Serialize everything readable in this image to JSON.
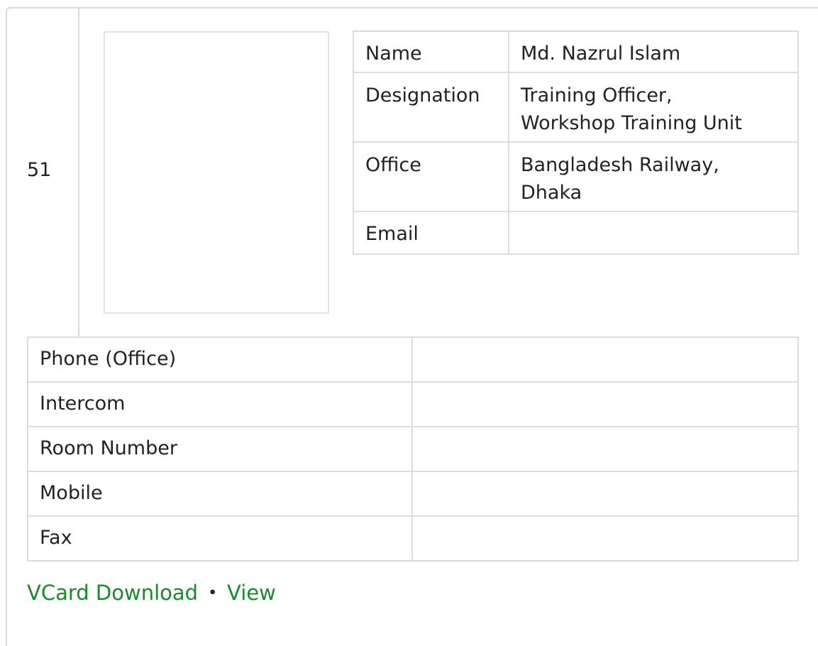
{
  "serial": "51",
  "info": {
    "name_label": "Name",
    "name_value": "Md. Nazrul Islam",
    "designation_label": "Designation",
    "designation_line1": "Training Officer,",
    "designation_line2": "Workshop Training Unit",
    "office_label": "Office",
    "office_line1": "Bangladesh Railway,",
    "office_line2": "Dhaka",
    "email_label": "Email",
    "email_value": ""
  },
  "contact": [
    {
      "label": "Phone (Office)",
      "value": ""
    },
    {
      "label": "Intercom",
      "value": ""
    },
    {
      "label": "Room Number",
      "value": ""
    },
    {
      "label": "Mobile",
      "value": ""
    },
    {
      "label": "Fax",
      "value": ""
    }
  ],
  "links": {
    "vcard": "VCard Download",
    "separator": "•",
    "view": "View",
    "color": "#1a8a2e"
  }
}
